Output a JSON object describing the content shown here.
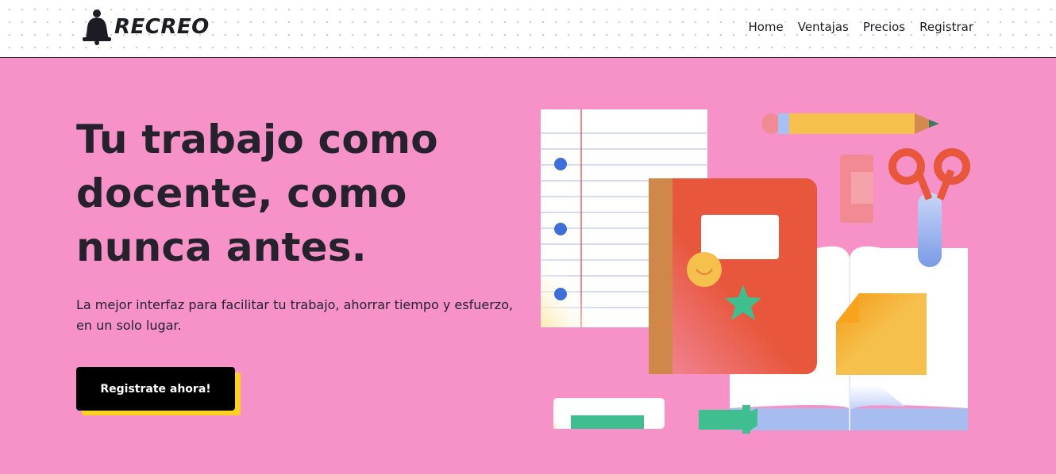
{
  "brand": {
    "name": "RECREO",
    "logo_icon": "bell-icon"
  },
  "nav": {
    "items": [
      {
        "label": "Home"
      },
      {
        "label": "Ventajas"
      },
      {
        "label": "Precios"
      },
      {
        "label": "Registrar"
      }
    ]
  },
  "hero": {
    "title_lines": [
      "Tu trabajo como",
      "docente, como",
      "nunca antes."
    ],
    "subtitle_lines": [
      "La mejor interfaz para facilitar tu trabajo, ahorrar tiempo y esfuerzo,",
      "en un solo lugar."
    ],
    "cta_label": "Registrate ahora!"
  },
  "illustration": {
    "name": "school-supplies-illustration",
    "items": [
      "lined-paper",
      "notebook",
      "pencil",
      "eraser",
      "scissors",
      "open-book",
      "sticky-note",
      "marker"
    ]
  },
  "colors": {
    "background": "#f692c8",
    "text": "#25222e",
    "cta_background": "#000000",
    "cta_shadow": "#ffd21f",
    "notebook": "#e8573c",
    "sticky_note": "#f6c04d"
  }
}
